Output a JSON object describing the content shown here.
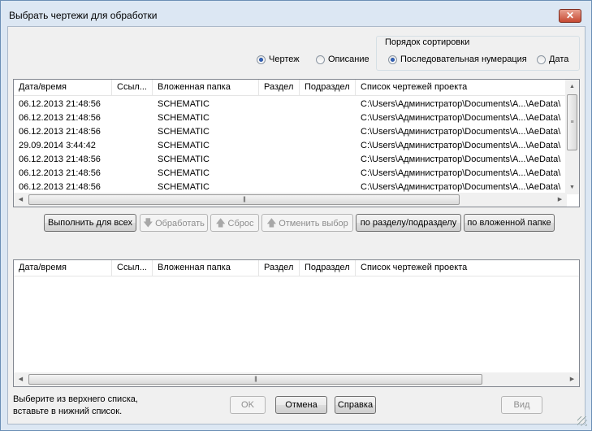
{
  "window": {
    "title": "Выбрать чертежи для обработки",
    "close_glyph": "✕"
  },
  "view_options": {
    "drawing_label": "Чертеж",
    "drawing_selected": true,
    "description_label": "Описание",
    "description_selected": false
  },
  "sort": {
    "group_label": "Порядок сортировки",
    "sequential_label": "Последовательная нумерация",
    "sequential_selected": true,
    "date_label": "Дата",
    "date_selected": false
  },
  "columns": [
    "Дата/время",
    "Ссыл...",
    "Вложенная папка",
    "Раздел",
    "Подраздел",
    "Список чертежей проекта"
  ],
  "top_rows": [
    [
      "06.12.2013 21:48:56",
      "",
      "SCHEMATIC",
      "",
      "",
      "C:\\Users\\Администратор\\Documents\\A...\\AeData\\"
    ],
    [
      "06.12.2013 21:48:56",
      "",
      "SCHEMATIC",
      "",
      "",
      "C:\\Users\\Администратор\\Documents\\A...\\AeData\\"
    ],
    [
      "06.12.2013 21:48:56",
      "",
      "SCHEMATIC",
      "",
      "",
      "C:\\Users\\Администратор\\Documents\\A...\\AeData\\"
    ],
    [
      "29.09.2014 3:44:42",
      "",
      "SCHEMATIC",
      "",
      "",
      "C:\\Users\\Администратор\\Documents\\A...\\AeData\\"
    ],
    [
      "06.12.2013 21:48:56",
      "",
      "SCHEMATIC",
      "",
      "",
      "C:\\Users\\Администратор\\Documents\\A...\\AeData\\"
    ],
    [
      "06.12.2013 21:48:56",
      "",
      "SCHEMATIC",
      "",
      "",
      "C:\\Users\\Администратор\\Documents\\A...\\AeData\\"
    ],
    [
      "06.12.2013 21:48:56",
      "",
      "SCHEMATIC",
      "",
      "",
      "C:\\Users\\Администратор\\Documents\\A...\\AeData\\"
    ]
  ],
  "bottom_rows": [],
  "toolbar": {
    "run_all": "Выполнить для всех",
    "process": "Обработать",
    "reset": "Сброс",
    "cancel_selection": "Отменить выбор",
    "by_section": "по разделу/подразделу",
    "by_subfolder": "по вложенной папке"
  },
  "hint": {
    "line1": "Выберите из верхнего списка,",
    "line2": "вставьте в нижний список."
  },
  "buttons": {
    "ok": "OK",
    "cancel": "Отмена",
    "help": "Справка",
    "view": "Вид"
  }
}
